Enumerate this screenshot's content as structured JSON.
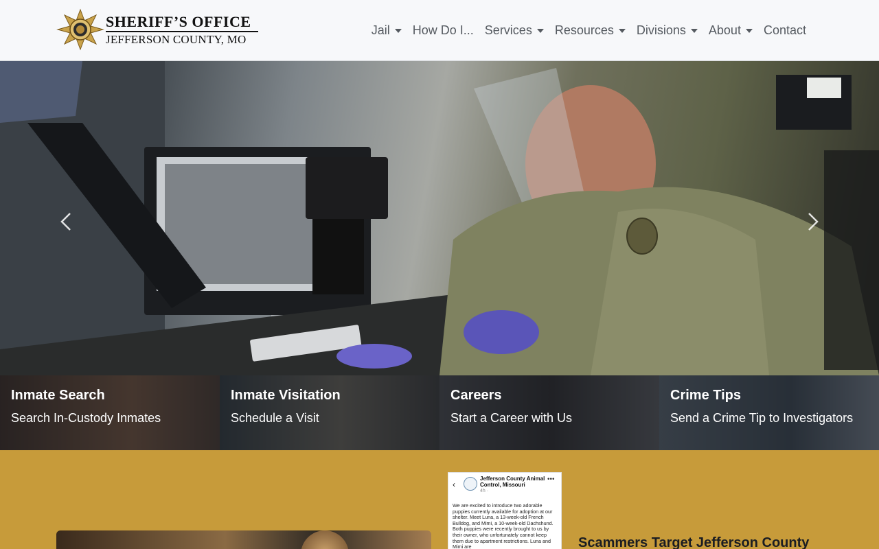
{
  "header": {
    "logo": {
      "title": "SHERIFF’S OFFICE",
      "subtitle": "JEFFERSON COUNTY, MO"
    },
    "nav": [
      {
        "label": "Jail",
        "dropdown": true
      },
      {
        "label": "How Do I...",
        "dropdown": false
      },
      {
        "label": "Services",
        "dropdown": true
      },
      {
        "label": "Resources",
        "dropdown": true
      },
      {
        "label": "Divisions",
        "dropdown": true
      },
      {
        "label": "About",
        "dropdown": true
      },
      {
        "label": "Contact",
        "dropdown": false
      }
    ]
  },
  "hero": {
    "prev_icon": "chevron-left-icon",
    "next_icon": "chevron-right-icon"
  },
  "tiles": [
    {
      "title": "Inmate Search",
      "subtitle": "Search In-Custody Inmates"
    },
    {
      "title": "Inmate Visitation",
      "subtitle": "Schedule a Visit"
    },
    {
      "title": "Careers",
      "subtitle": "Start a Career with Us"
    },
    {
      "title": "Crime Tips",
      "subtitle": "Send a Crime Tip to Investigators"
    }
  ],
  "social_post": {
    "account_name": "Jefferson County Animal Control, Missouri",
    "time": "4h · ",
    "body": "We are excited to introduce two adorable puppies currently available for adoption at our shelter. Meet Luna, a 13-week-old French Bulldog, and Mimi, a 10-week-old Dachshund. Both puppies were recently brought to us by their owner, who unfortunately cannot keep them due to apartment restrictions. Luna and Mimi are"
  },
  "news": {
    "headline": "Scammers Target Jefferson County"
  },
  "colors": {
    "gold_band": "#c79b3a",
    "header_bg": "#f7f8fa",
    "nav_text": "#555a60"
  }
}
